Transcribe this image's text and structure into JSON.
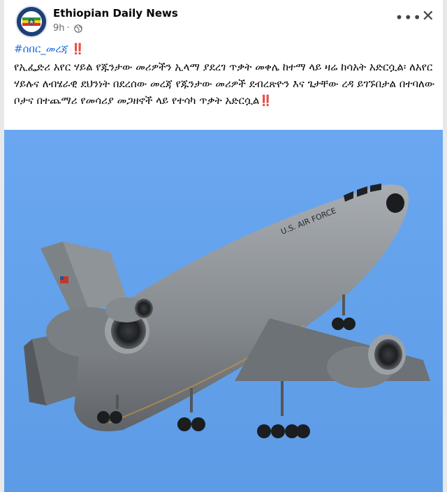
{
  "post": {
    "page_name": "Ethiopian Daily News",
    "time": "9h",
    "audience_icon": "globe-icon",
    "more_icon": "more-options-icon",
    "close_icon": "close-icon",
    "hashtag": "#ሰበር_መረጃ",
    "hashtag_emoji": "‼️",
    "body": "የኢፌድሪ አየር ሃይል የጁንታው መሪዎችን ኢላማ ያደረገ ጥቃት መቀሌ ከተማ ላይ ዛሬ ከሳአት አድርሷል፡ ለአየር ሃይሉና ለብሄራዊ ደህንነት በደረሰው መረጃ የጁንታው መሪዎች ደብረጽዮን እና ጌታቸው ረዳ ይገኙበታል በተባለው ቦታና በተጨማሪ የመሳሪያ መጋዘኖች ላይ የተሳካ ጥቃት አድርሷል",
    "body_emoji": "‼️"
  },
  "photo": {
    "fuselage_text": "U.S. AIR FORCE",
    "sky_color": "#6aa6ee",
    "aircraft_color": "#8c9196"
  },
  "colors": {
    "link": "#216fdb",
    "alarm": "#e41e2b",
    "meta": "#65676b"
  }
}
